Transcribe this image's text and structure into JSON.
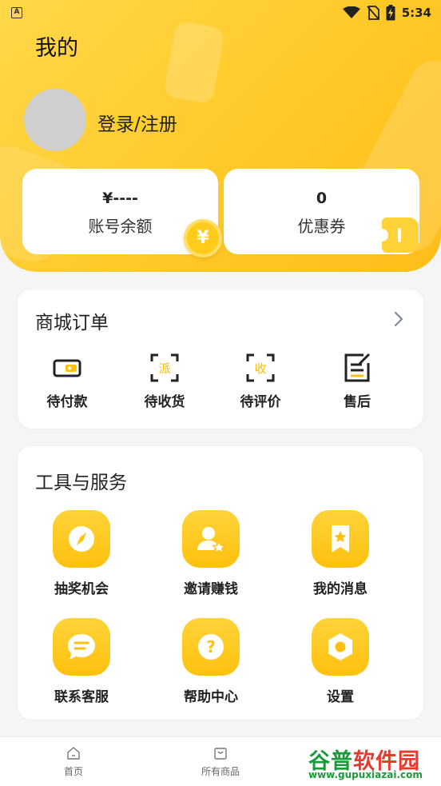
{
  "status_bar": {
    "notification_icon": "A",
    "time": "5:34",
    "icons": [
      "wifi-icon",
      "no-sim-icon",
      "battery-charging-icon"
    ]
  },
  "header": {
    "title": "我的",
    "login_text": "登录/注册"
  },
  "cards": {
    "balance": {
      "value": "¥----",
      "label": "账号余额",
      "badge": "¥"
    },
    "coupon": {
      "value": "0",
      "label": "优惠券"
    }
  },
  "orders": {
    "title": "商城订单",
    "items": [
      {
        "label": "待付款",
        "icon": "wallet-icon"
      },
      {
        "label": "待收货",
        "icon": "delivery-icon",
        "glyph": "派"
      },
      {
        "label": "待评价",
        "icon": "receive-icon",
        "glyph": "收"
      },
      {
        "label": "售后",
        "icon": "edit-note-icon"
      }
    ]
  },
  "tools": {
    "title": "工具与服务",
    "items": [
      {
        "label": "抽奖机会",
        "icon": "compass-icon"
      },
      {
        "label": "邀请赚钱",
        "icon": "invite-user-icon"
      },
      {
        "label": "我的消息",
        "icon": "bookmark-star-icon"
      },
      {
        "label": "联系客服",
        "icon": "chat-bubble-icon"
      },
      {
        "label": "帮助中心",
        "icon": "question-icon"
      },
      {
        "label": "设置",
        "icon": "settings-icon"
      }
    ]
  },
  "tabbar": {
    "items": [
      {
        "label": "首页",
        "icon": "home-icon"
      },
      {
        "label": "所有商品",
        "icon": "shopping-bag-icon"
      }
    ]
  },
  "watermark": {
    "brand_green": "谷普",
    "brand_red": "软件园",
    "url": "www.gupuxiazai.com"
  },
  "colors": {
    "primary_yellow": "#ffc928",
    "icon_yellow": "#ffc10e",
    "text_dark": "#222222",
    "background": "#f5f5f5"
  }
}
